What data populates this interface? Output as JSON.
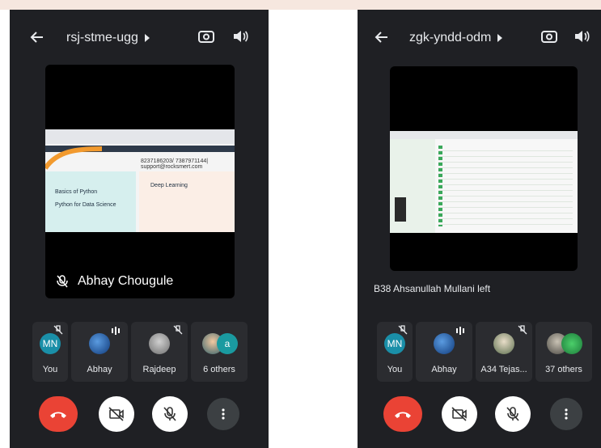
{
  "left": {
    "title": "rsj-stme-ugg",
    "presenter_name": "Abhay Chougule",
    "slide": {
      "contact": "8237186203/ 7387971144| support@",
      "contact2": "rocksmert.com",
      "menu_items": [
        "Basics of Python",
        "Python for Data Science"
      ],
      "right_heading": "Deep Learning"
    },
    "tiles": [
      {
        "initials": "MN",
        "label": "You"
      },
      {
        "label": "Abhay"
      },
      {
        "label": "Rajdeep"
      },
      {
        "extra_initial": "a",
        "label": "6 others"
      }
    ]
  },
  "right": {
    "title": "zgk-yndd-odm",
    "status": "B38 Ahsanullah Mullani left",
    "tiles": [
      {
        "initials": "MN",
        "label": "You"
      },
      {
        "label": "Abhay"
      },
      {
        "label": "A34 Tejas..."
      },
      {
        "label": "37 others"
      }
    ]
  },
  "colors": {
    "panel_bg": "#1f2024",
    "tile_bg": "#2b2c30",
    "hangup": "#ea4335",
    "avatar_teal": "#1a8fa8"
  },
  "icons": [
    "back-arrow-icon",
    "chevron-right-icon",
    "switch-camera-icon",
    "speaker-icon",
    "mic-off-icon",
    "audio-bars-icon",
    "hang-up-icon",
    "camera-off-icon",
    "more-vert-icon"
  ]
}
